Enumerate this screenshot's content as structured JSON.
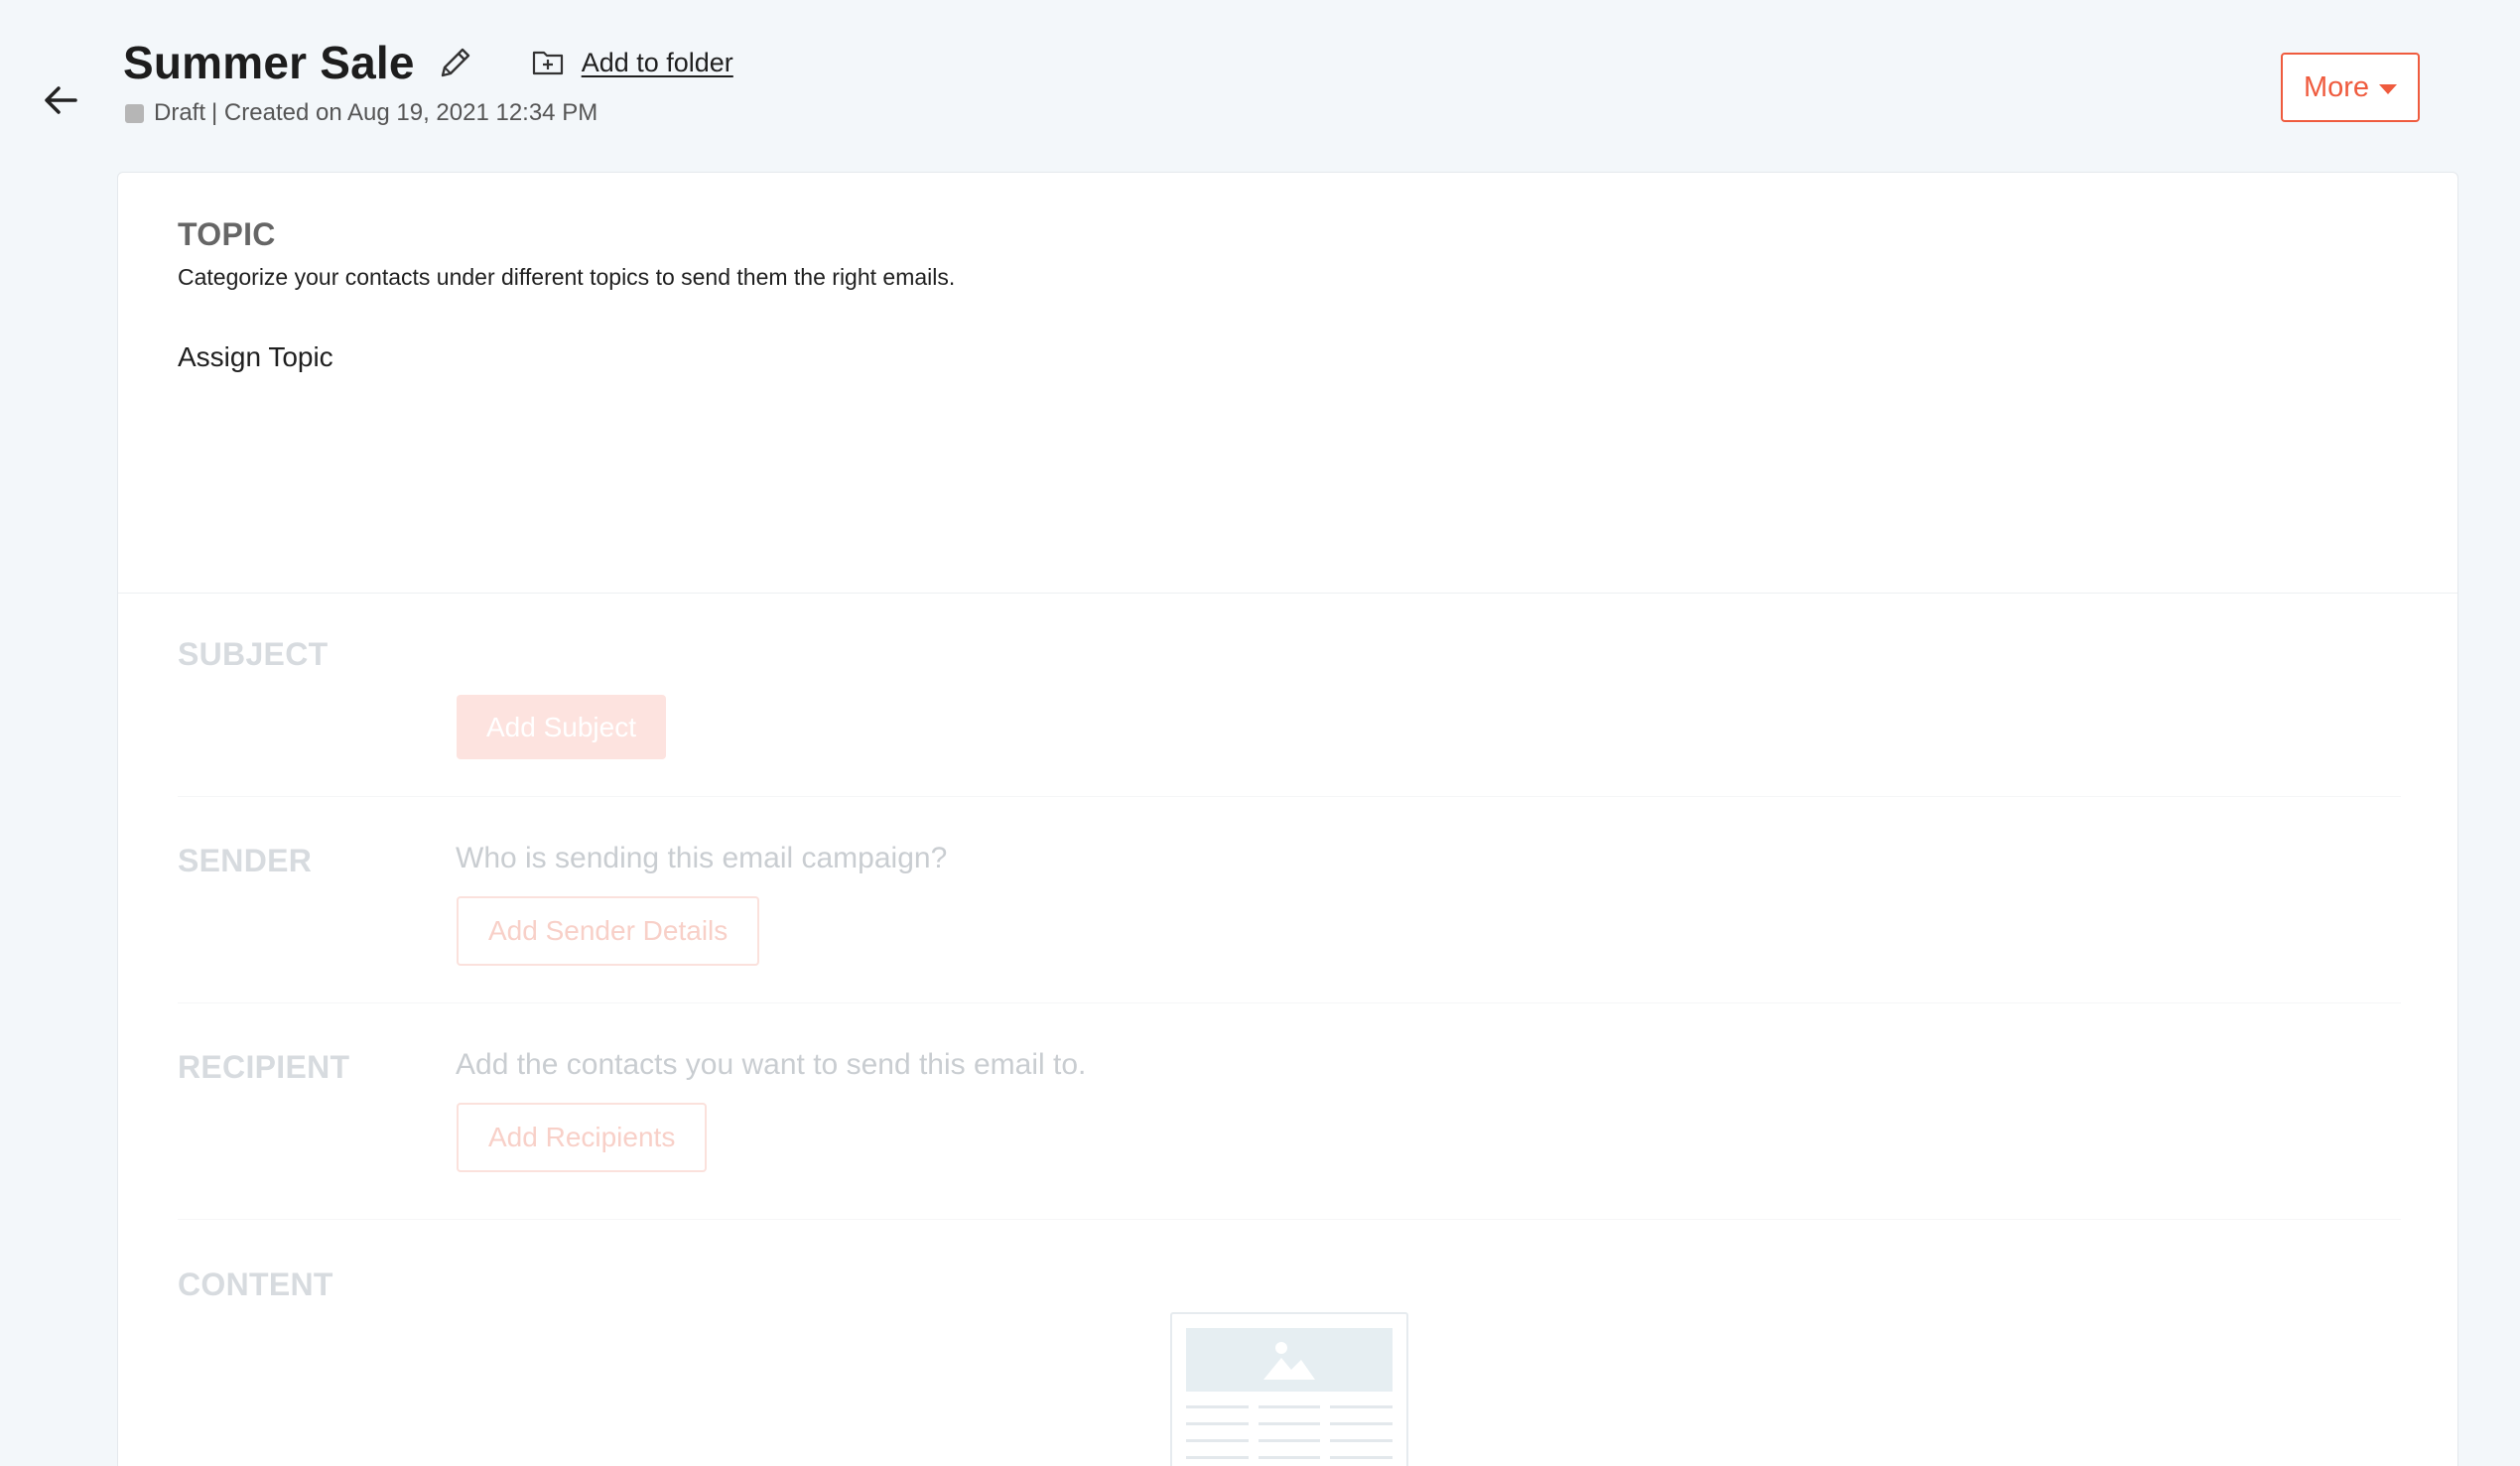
{
  "header": {
    "title": "Summer Sale",
    "add_to_folder": "Add to folder",
    "status": "Draft",
    "created": "| Created on Aug 19, 2021 12:34 PM",
    "more_label": "More"
  },
  "topic": {
    "title": "TOPIC",
    "description": "Categorize your contacts under different topics to send them the right emails.",
    "assign_label": "Assign Topic"
  },
  "subject": {
    "title": "SUBJECT",
    "button_label": "Add Subject"
  },
  "sender": {
    "title": "SENDER",
    "prompt": "Who is sending this email campaign?",
    "button_label": "Add Sender Details"
  },
  "recipient": {
    "title": "RECIPIENT",
    "prompt": "Add the contacts you want to send this email to.",
    "button_label": "Add Recipients"
  },
  "content": {
    "title": "CONTENT"
  },
  "colors": {
    "accent": "#ef5b3e",
    "background": "#f3f7fa",
    "status_draft": "#b6b6b6"
  }
}
